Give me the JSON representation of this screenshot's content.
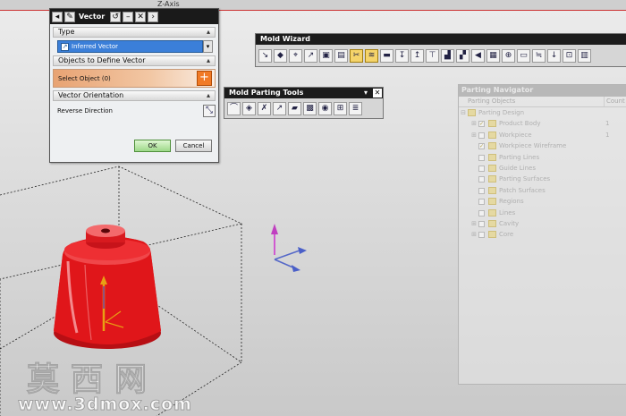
{
  "viewport": {
    "axis_label": "Z-Axis",
    "background_top": "#ececec",
    "background_bottom": "#c9c9c9",
    "part_color": "#e0161a"
  },
  "vector_dialog": {
    "title": "Vector",
    "title_buttons": [
      "back-arrow-icon",
      "wrench-icon",
      "reset-icon",
      "minimize-icon",
      "close-icon"
    ],
    "type_section": "Type",
    "type_value": "Inferred Vector",
    "objects_section": "Objects to Define Vector",
    "select_object": "Select Object (0)",
    "orientation_section": "Vector Orientation",
    "reverse_direction": "Reverse Direction",
    "ok": "OK",
    "cancel": "Cancel"
  },
  "mold_wizard": {
    "title": "Mold Wizard",
    "icons": [
      "project-init-icon",
      "family-mold-icon",
      "mold-csys-icon",
      "shrinkage-icon",
      "workpiece-icon",
      "layout-icon",
      "mold-tools-icon",
      "parting-icon",
      "mold-base-icon",
      "standard-part-icon",
      "ejector-pin-icon",
      "post-process-icon",
      "slider-icon",
      "subinsert-icon",
      "gate-icon",
      "runner-icon",
      "cooling-icon",
      "electrode-icon",
      "trim-icon",
      "pocket-icon",
      "bill-of-material-icon",
      "drawing-icon"
    ],
    "active_icons": [
      "mold-tools-icon",
      "parting-icon"
    ],
    "icon_glyphs": [
      "↘",
      "◆",
      "⌖",
      "↗",
      "▣",
      "▤",
      "✂",
      "≋",
      "▬",
      "↧",
      "↥",
      "⊤",
      "▟",
      "▞",
      "◀",
      "▦",
      "⊕",
      "▭",
      "≒",
      "↓",
      "⊡",
      "▥"
    ]
  },
  "mold_parting": {
    "title": "Mold Parting Tools",
    "icons": [
      "region-analysis-icon",
      "mold-design-validation-icon",
      "curves-icon",
      "parting-surface-icon",
      "patch-icon",
      "define-region-icon",
      "design-parting-icon",
      "copy-icon",
      "parting-navigator-icon"
    ],
    "icon_glyphs": [
      "⌒",
      "◈",
      "✗",
      "↗",
      "▰",
      "▩",
      "◉",
      "⊞",
      "≣"
    ]
  },
  "parting_navigator": {
    "title": "Parting Navigator",
    "column_objects": "Parting Objects",
    "column_count": "Count",
    "rows": [
      {
        "label": "Parting Design",
        "count": "",
        "level": 0,
        "expander": "⊟",
        "checked": false
      },
      {
        "label": "Product Body",
        "count": "1",
        "level": 1,
        "expander": "⊞",
        "checked": true
      },
      {
        "label": "Workpiece",
        "count": "1",
        "level": 1,
        "expander": "⊞",
        "checked": false
      },
      {
        "label": "Workpiece Wireframe",
        "count": "",
        "level": 1,
        "expander": "",
        "checked": true
      },
      {
        "label": "Parting Lines",
        "count": "",
        "level": 1,
        "expander": "",
        "checked": false
      },
      {
        "label": "Guide Lines",
        "count": "",
        "level": 1,
        "expander": "",
        "checked": false
      },
      {
        "label": "Parting Surfaces",
        "count": "",
        "level": 1,
        "expander": "",
        "checked": false
      },
      {
        "label": "Patch Surfaces",
        "count": "",
        "level": 1,
        "expander": "",
        "checked": false
      },
      {
        "label": "Regions",
        "count": "",
        "level": 1,
        "expander": "",
        "checked": false
      },
      {
        "label": "Lines",
        "count": "",
        "level": 1,
        "expander": "",
        "checked": false
      },
      {
        "label": "Cavity",
        "count": "",
        "level": 1,
        "expander": "⊞",
        "checked": false
      },
      {
        "label": "Core",
        "count": "",
        "level": 1,
        "expander": "⊞",
        "checked": false
      }
    ]
  },
  "watermark": {
    "chinese": "莫西网",
    "url": "www.3dmox.com"
  }
}
